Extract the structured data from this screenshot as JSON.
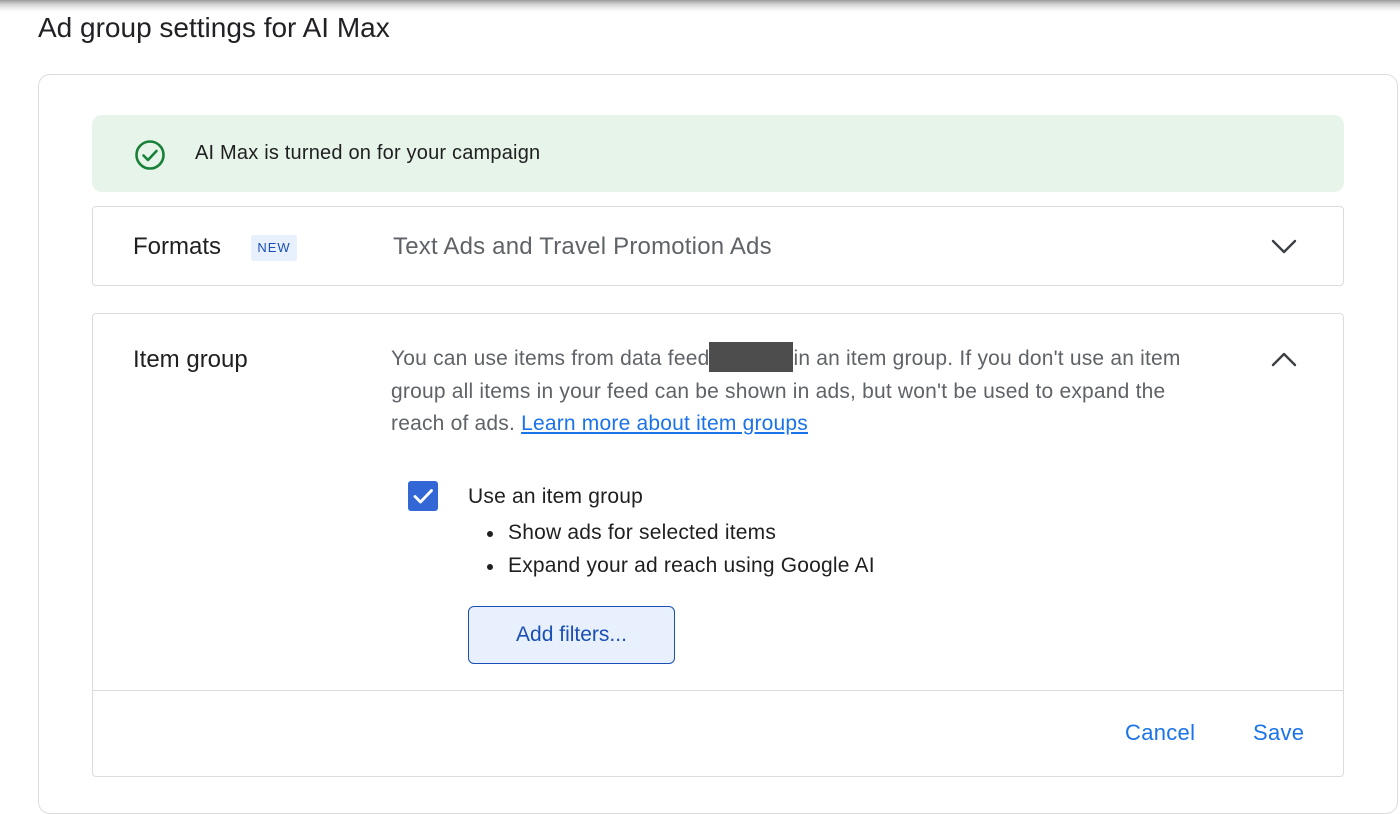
{
  "page": {
    "title": "Ad group settings for AI Max"
  },
  "banner": {
    "text": "AI Max is turned on for your campaign",
    "icon": "check-circle-icon",
    "color": "#e6f4ea"
  },
  "formats": {
    "label": "Formats",
    "badge": "NEW",
    "value": "Text Ads and Travel Promotion Ads",
    "expanded": false,
    "icon": "chevron-down-icon"
  },
  "item_group": {
    "label": "Item group",
    "expanded": true,
    "icon": "chevron-up-icon",
    "description_part1": "You can use items from data feed",
    "description_part2": "in an item group. If you don't use an item group all items in your feed can be shown in ads, but won't be used to expand the reach of ads.",
    "learn_more_link": "Learn more about item groups",
    "checkbox": {
      "label": "Use an item group",
      "checked": true
    },
    "bullets": [
      "Show ads for selected items",
      "Expand your ad reach using Google AI"
    ],
    "add_filters_label": "Add filters...",
    "cancel_label": "Cancel",
    "save_label": "Save"
  },
  "colors": {
    "accent": "#1a73e8",
    "checkbox": "#3367d6",
    "banner_bg": "#e6f4ea",
    "success_green": "#188038"
  }
}
